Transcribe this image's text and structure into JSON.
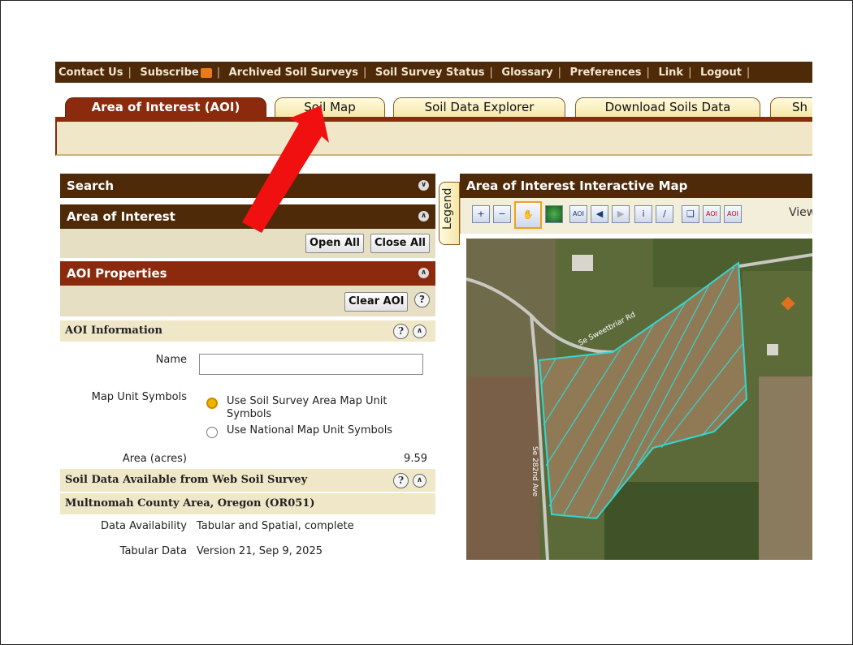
{
  "top_links": [
    "Contact Us",
    "Subscribe",
    "Archived Soil Surveys",
    "Soil Survey Status",
    "Glossary",
    "Preferences",
    "Link",
    "Logout"
  ],
  "tabs": [
    {
      "label": "Area of Interest (AOI)",
      "active": true
    },
    {
      "label": "Soil Map",
      "active": false
    },
    {
      "label": "Soil Data Explorer",
      "active": false
    },
    {
      "label": "Download Soils Data",
      "active": false
    },
    {
      "label": "Sh",
      "active": false
    }
  ],
  "left": {
    "search_header": "Search",
    "aoi_header": "Area of Interest",
    "open_all": "Open All",
    "close_all": "Close All",
    "aoi_props_header": "AOI Properties",
    "clear_aoi": "Clear AOI",
    "aoi_info_header": "AOI Information",
    "name_label": "Name",
    "name_value": "",
    "map_unit_label": "Map Unit Symbols",
    "radio_options": [
      "Use Soil Survey Area Map Unit Symbols",
      "Use National Map Unit Symbols"
    ],
    "selected_radio": 0,
    "area_label": "Area (acres)",
    "area_value": "9.59",
    "soil_data_header": "Soil Data Available from Web Soil Survey",
    "survey_area": "Multnomah County Area, Oregon (OR051)",
    "data_availability_label": "Data Availability",
    "data_availability_value": "Tabular and Spatial, complete",
    "tabular_data_label": "Tabular Data",
    "tabular_data_value": "Version 21, Sep 9, 2025"
  },
  "map": {
    "header": "Area of Interest Interactive Map",
    "legend_tab": "Legend",
    "view_label": "View",
    "road_labels": [
      "Se Sweetbriar Rd",
      "Se 282nd Ave"
    ],
    "tools": [
      "zoom-in",
      "zoom-out",
      "pan",
      "full-extent",
      "aoi-point",
      "back",
      "forward",
      "identify",
      "measure",
      "copy",
      "aoi-rectangle",
      "aoi-polygon"
    ],
    "selected_tool": "pan",
    "aoi_outline_color": "#35d6d0"
  },
  "annotation": {
    "arrow_color": "#f01010",
    "points_to": "Soil Map"
  }
}
